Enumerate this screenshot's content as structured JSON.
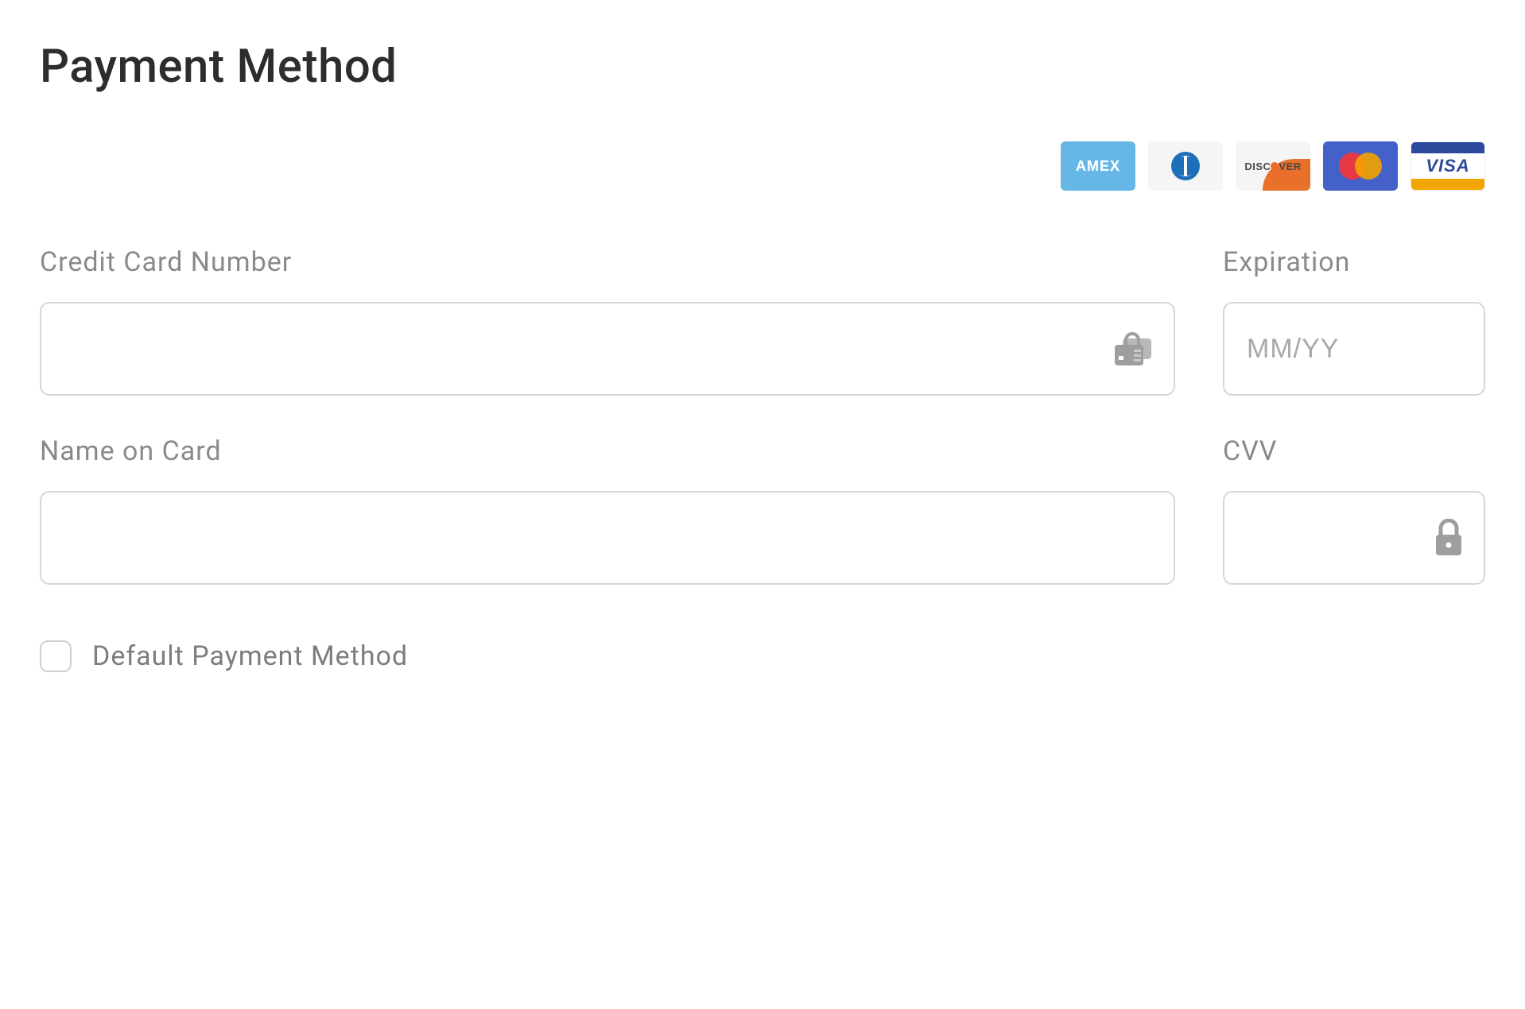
{
  "title": "Payment Method",
  "card_brands": {
    "amex": "AMEX",
    "diners": "diners",
    "discover_pre": "DISC",
    "discover_post": "VER",
    "mastercard": "mastercard",
    "visa": "VISA"
  },
  "fields": {
    "card_number": {
      "label": "Credit Card Number",
      "value": "",
      "placeholder": ""
    },
    "expiration": {
      "label": "Expiration",
      "value": "",
      "placeholder": "MM/YY"
    },
    "name_on_card": {
      "label": "Name on Card",
      "value": "",
      "placeholder": ""
    },
    "cvv": {
      "label": "CVV",
      "value": "",
      "placeholder": ""
    }
  },
  "default_payment": {
    "label": "Default Payment Method",
    "checked": false
  }
}
